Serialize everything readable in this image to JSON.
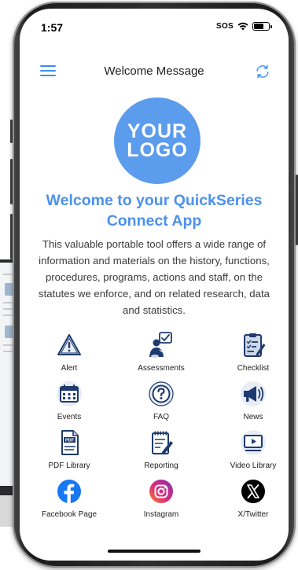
{
  "status_bar": {
    "time": "1:57",
    "sos": "SOS"
  },
  "navbar": {
    "title": "Welcome Message",
    "menu_icon": "hamburger-menu-icon",
    "sync_icon": "sync-icon"
  },
  "logo": {
    "line1": "YOUR",
    "line2": "LOGO"
  },
  "welcome": {
    "heading": "Welcome to your QuickSeries Connect App",
    "body": "This valuable portable tool offers a wide range of information and materials on the history, functions, procedures, programs, actions and staff, on the statutes we enforce, and on related research, data and statistics."
  },
  "tiles": [
    {
      "label": "Alert",
      "icon": "alert-triangle-icon"
    },
    {
      "label": "Assessments",
      "icon": "assessment-person-icon"
    },
    {
      "label": "Checklist",
      "icon": "checklist-clipboard-icon"
    },
    {
      "label": "Events",
      "icon": "calendar-icon"
    },
    {
      "label": "FAQ",
      "icon": "question-circle-icon"
    },
    {
      "label": "News",
      "icon": "megaphone-icon"
    },
    {
      "label": "PDF Library",
      "icon": "pdf-document-icon"
    },
    {
      "label": "Reporting",
      "icon": "notepad-pencil-icon"
    },
    {
      "label": "Video Library",
      "icon": "video-play-icon"
    },
    {
      "label": "Facebook Page",
      "icon": "facebook-icon"
    },
    {
      "label": "Instagram",
      "icon": "instagram-icon"
    },
    {
      "label": "X/Twitter",
      "icon": "x-twitter-icon"
    }
  ],
  "colors": {
    "accent": "#4d91ea",
    "logo_bg": "#5b9cec",
    "icon_navy": "#1e3a6e",
    "icon_light": "#cfd8e6",
    "facebook": "#1877f2",
    "instagram": "#e1306c",
    "x": "#000000"
  }
}
